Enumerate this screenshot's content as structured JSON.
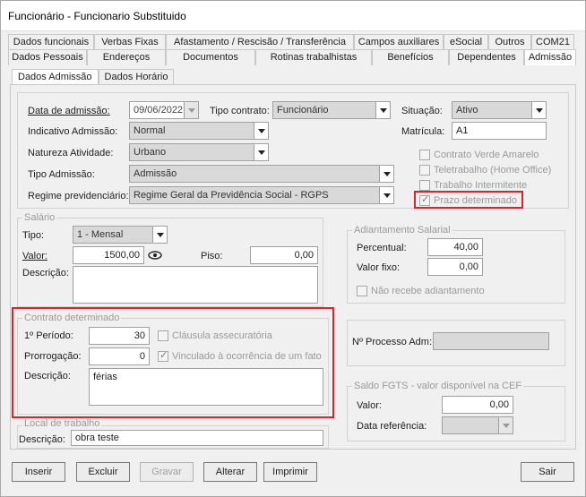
{
  "window": {
    "title": "Funcionário - Funcionario Substituido"
  },
  "tabs_row1": [
    "Dados funcionais",
    "Verbas Fixas",
    "Afastamento / Rescisão / Transferência",
    "Campos auxiliares",
    "eSocial",
    "Outros",
    "COM21"
  ],
  "tabs_row2": [
    "Dados Pessoais",
    "Endereços",
    "Documentos",
    "Rotinas trabalhistas",
    "Benefícios",
    "Dependentes",
    "Admissão"
  ],
  "subtabs": [
    "Dados Admissão",
    "Dados Horário"
  ],
  "admission": {
    "data_label": "Data de admissão:",
    "data_value": "09/06/2022",
    "tipo_contrato_label": "Tipo contrato:",
    "tipo_contrato_value": "Funcionário",
    "indicativo_label": "Indicativo Admissão:",
    "indicativo_value": "Normal",
    "natureza_label": "Natureza Atividade:",
    "natureza_value": "Urbano",
    "tipo_admissao_label": "Tipo Admissão:",
    "tipo_admissao_value": "Admissão",
    "regime_label": "Regime previdenciário:",
    "regime_value": "Regime Geral da Previdência Social - RGPS",
    "situacao_label": "Situação:",
    "situacao_value": "Ativo",
    "matricula_label": "Matrícula:",
    "matricula_value": "A1"
  },
  "flags": [
    {
      "label": "Contrato Verde Amarelo",
      "checked": false
    },
    {
      "label": "Teletrabalho (Home Office)",
      "checked": false
    },
    {
      "label": "Trabalho Intermitente",
      "checked": false
    },
    {
      "label": "Prazo determinado",
      "checked": true
    }
  ],
  "salario": {
    "legend": "Salário",
    "tipo_label": "Tipo:",
    "tipo_value": "1 - Mensal",
    "valor_label": "Valor:",
    "valor_value": "1500,00",
    "piso_label": "Piso:",
    "piso_value": "0,00",
    "descricao_label": "Descrição:",
    "descricao_value": ""
  },
  "adiantamento": {
    "legend": "Adiantamento Salarial",
    "percentual_label": "Percentual:",
    "percentual_value": "40,00",
    "valor_fixo_label": "Valor fixo:",
    "valor_fixo_value": "0,00",
    "nao_recebe_label": "Não recebe adiantamento"
  },
  "contrato": {
    "legend": "Contrato determinado",
    "periodo_label": "1º Período:",
    "periodo_value": "30",
    "prorrogacao_label": "Prorrogação:",
    "prorrogacao_value": "0",
    "clausula_label": "Cláusula assecuratória",
    "vinculado_label": "Vinculado à ocorrência de um fato",
    "descricao_label": "Descrição:",
    "descricao_value": "férias"
  },
  "processo": {
    "label": "Nº Processo Adm:",
    "value": ""
  },
  "fgts": {
    "legend": "Saldo FGTS - valor disponível na CEF",
    "valor_label": "Valor:",
    "valor_value": "0,00",
    "data_label": "Data referência:",
    "data_value": ""
  },
  "local": {
    "legend": "Local de trabalho",
    "descricao_label": "Descrição:",
    "descricao_value": "obra teste"
  },
  "buttons": {
    "inserir": "Inserir",
    "excluir": "Excluir",
    "gravar": "Gravar",
    "alterar": "Alterar",
    "imprimir": "Imprimir",
    "sair": "Sair"
  },
  "colors": {
    "highlight": "#d9262c",
    "readonly": "#d9d9d9",
    "face": "#f0f0f0"
  }
}
